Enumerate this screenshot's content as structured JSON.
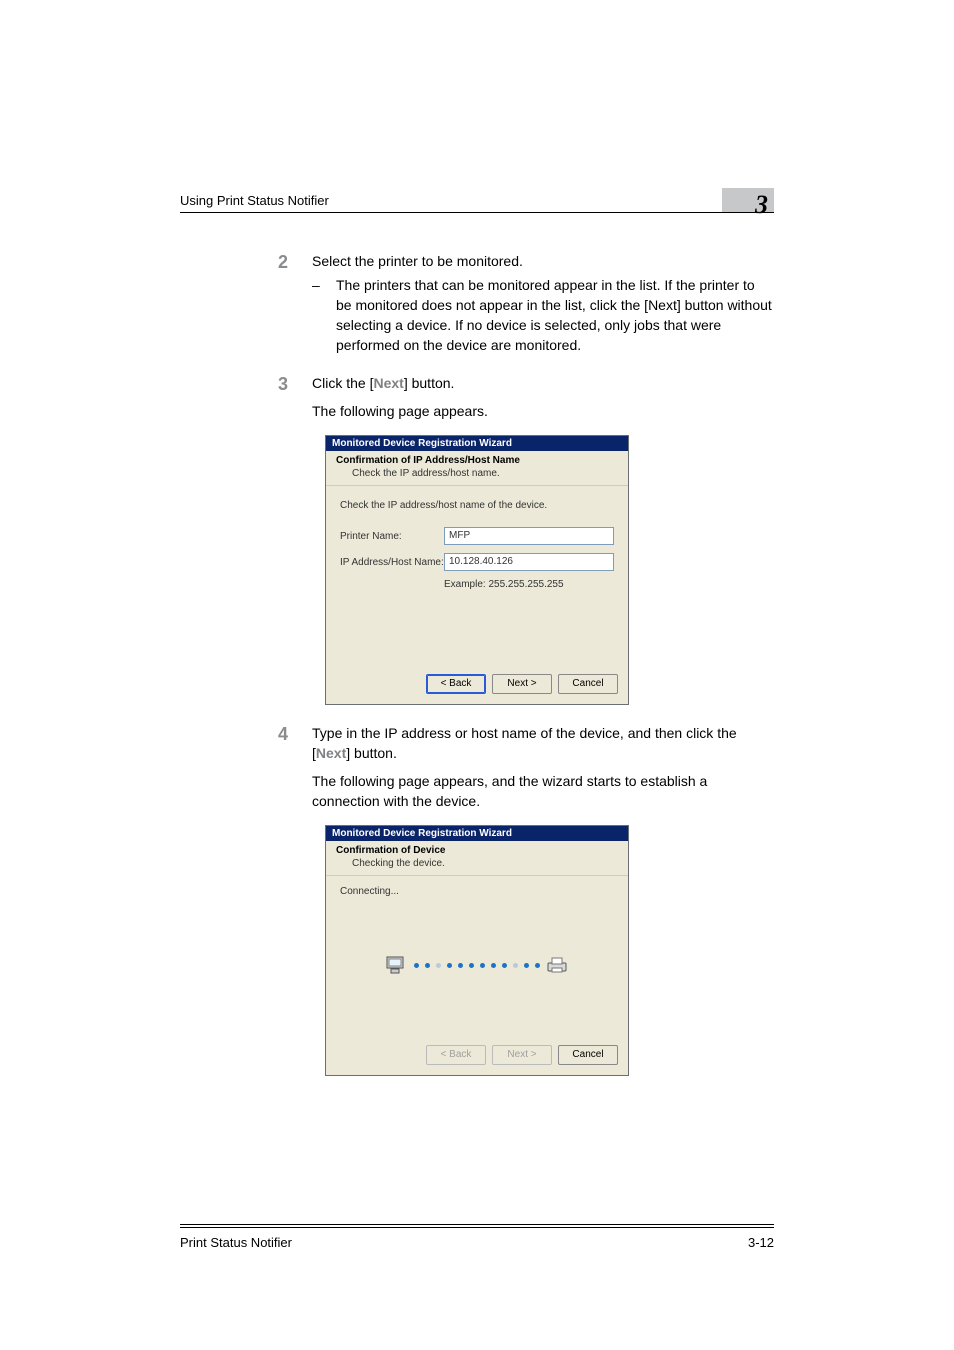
{
  "header": {
    "section_title": "Using Print Status Notifier",
    "chapter_number": "3"
  },
  "steps": [
    {
      "num": "2",
      "text": "Select the printer to be monitored.",
      "subs": [
        "The printers that can be monitored appear in the list. If the printer to be monitored does not appear in the list, click the [Next] button without selecting a device. If no device is selected, only jobs that were performed on the device are monitored."
      ]
    },
    {
      "num": "3",
      "text": "Click the [Next] button.",
      "followup": "The following page appears."
    },
    {
      "num": "4",
      "text": "Type in the IP address or host name of the device, and then click the [Next] button.",
      "followup": "The following page appears, and the wizard starts to establish a connection with the device."
    }
  ],
  "inline_bold": {
    "next": "Next"
  },
  "dialog1": {
    "title": "Monitored Device Registration Wizard",
    "heading": "Confirmation of IP Address/Host Name",
    "heading_sub": "Check the IP address/host name.",
    "body_msg": "Check the IP address/host name of the device.",
    "printer_label": "Printer Name:",
    "printer_value": "MFP",
    "ip_label": "IP Address/Host Name:",
    "ip_value": "10.128.40.126",
    "hint": "Example: 255.255.255.255",
    "back": "< Back",
    "next": "Next >",
    "cancel": "Cancel"
  },
  "dialog2": {
    "title": "Monitored Device Registration Wizard",
    "heading": "Confirmation of Device",
    "heading_sub": "Checking the device.",
    "connecting": "Connecting...",
    "back": "< Back",
    "next": "Next >",
    "cancel": "Cancel"
  },
  "footer": {
    "product": "Print Status Notifier",
    "page": "3-12"
  }
}
